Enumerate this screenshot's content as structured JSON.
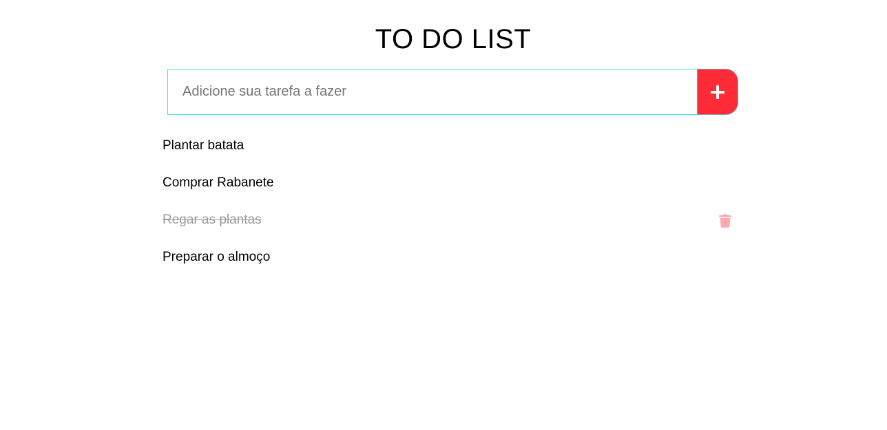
{
  "header": {
    "title": "TO DO LIST"
  },
  "add_form": {
    "placeholder": "Adicione sua tarefa a fazer",
    "value": "",
    "add_button_icon": "plus-icon",
    "accent_color": "#ff2b36",
    "input_border_color": "#41e0e6"
  },
  "tasks": [
    {
      "label": "Plantar batata",
      "done": false
    },
    {
      "label": "Comprar Rabanete",
      "done": false
    },
    {
      "label": "Regar as plantas",
      "done": true,
      "delete_icon": "trash-icon",
      "delete_icon_color": "#ffa8ad"
    },
    {
      "label": "Preparar o almoço",
      "done": false
    }
  ]
}
